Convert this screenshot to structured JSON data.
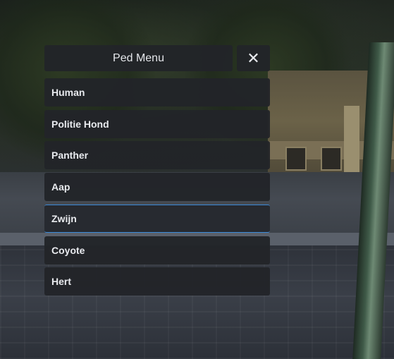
{
  "menu": {
    "title": "Ped Menu",
    "close_glyph": "✕",
    "close_icon": "close-icon",
    "selected_index": 4,
    "accent_color": "#3b8ad8",
    "items": [
      {
        "label": "Human"
      },
      {
        "label": "Politie Hond"
      },
      {
        "label": "Panther"
      },
      {
        "label": "Aap"
      },
      {
        "label": "Zwijn"
      },
      {
        "label": "Coyote"
      },
      {
        "label": "Hert"
      }
    ]
  }
}
